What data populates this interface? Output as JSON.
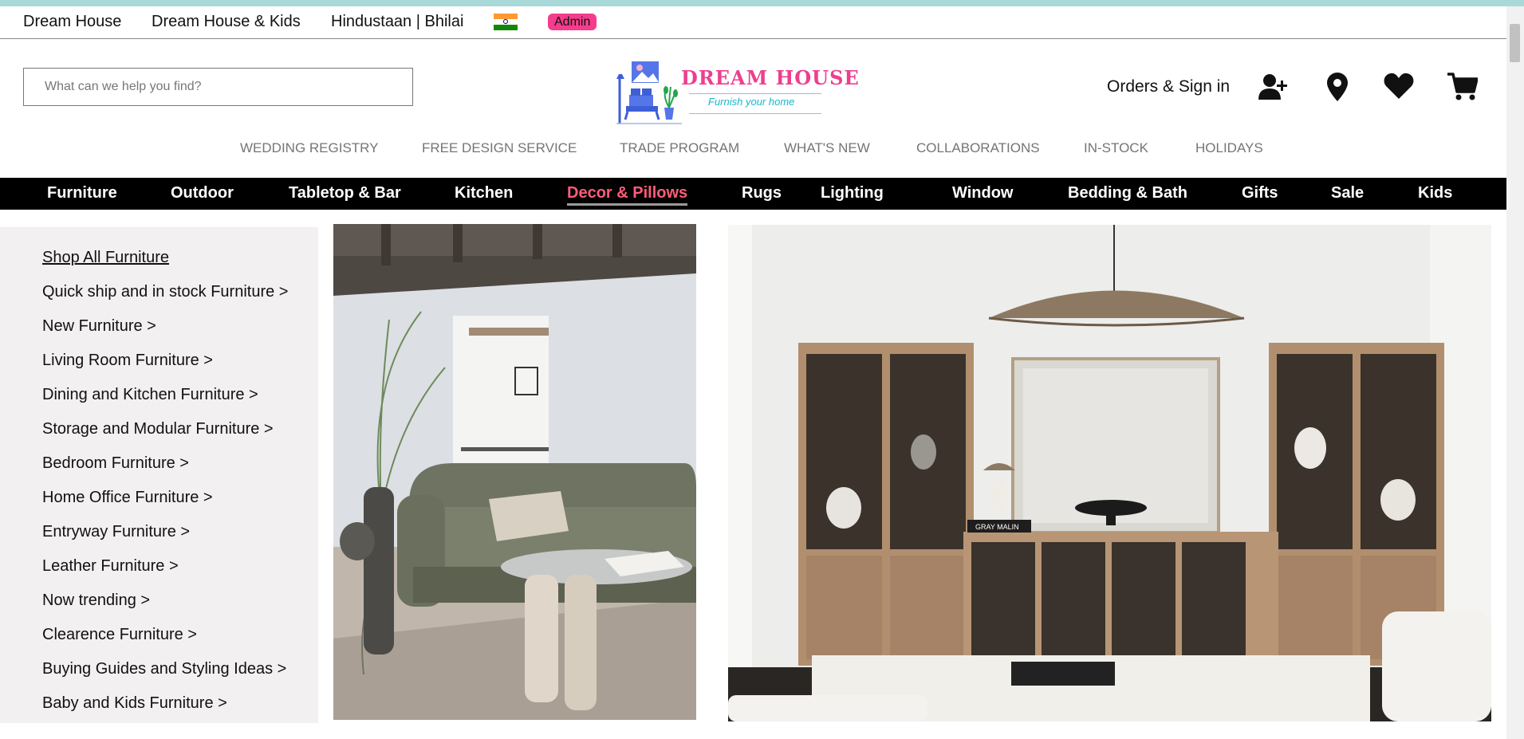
{
  "topbar": {
    "links": [
      "Dream House",
      "Dream House & Kids",
      "Hindustaan | Bhilai"
    ],
    "flag_icon": "india-flag-icon",
    "admin_badge": "Admin",
    "admin_color": "#f43d8c"
  },
  "search": {
    "placeholder": "What can we help you find?",
    "value": ""
  },
  "logo": {
    "title": "DREAM HOUSE",
    "tagline": "Furnish your home"
  },
  "account": {
    "label": "Orders & Sign in",
    "icons": [
      "add-user-icon",
      "location-pin-icon",
      "heart-icon",
      "cart-icon"
    ]
  },
  "subnav": [
    "WEDDING REGISTRY",
    "FREE DESIGN SERVICE",
    "TRADE PROGRAM",
    "WHAT'S NEW",
    "COLLABORATIONS",
    "IN-STOCK",
    "HOLIDAYS"
  ],
  "main_nav": {
    "items": [
      "Furniture",
      "Outdoor",
      "Tabletop & Bar",
      "Kitchen",
      "Decor & Pillows",
      "Rugs",
      "Lighting",
      "Window",
      "Bedding & Bath",
      "Gifts",
      "Sale",
      "Kids"
    ],
    "active": "Decor & Pillows",
    "active_color": "#ff5c7a"
  },
  "side_menu": [
    "Shop All Furniture",
    "Quick ship and in stock Furniture >",
    "New Furniture >",
    "Living Room Furniture >",
    "Dining and Kitchen Furniture >",
    "Storage and Modular Furniture >",
    "Bedroom Furniture >",
    "Home Office Furniture >",
    "Entryway Furniture >",
    "Leather Furniture >",
    "Now trending >",
    "Clearence Furniture >",
    "Buying Guides and Styling Ideas >",
    "Baby and Kids Furniture >"
  ],
  "photos": [
    "living-room-sofa-photo",
    "storage-cabinets-photo"
  ],
  "photo_book_text": "GRAY MALIN"
}
